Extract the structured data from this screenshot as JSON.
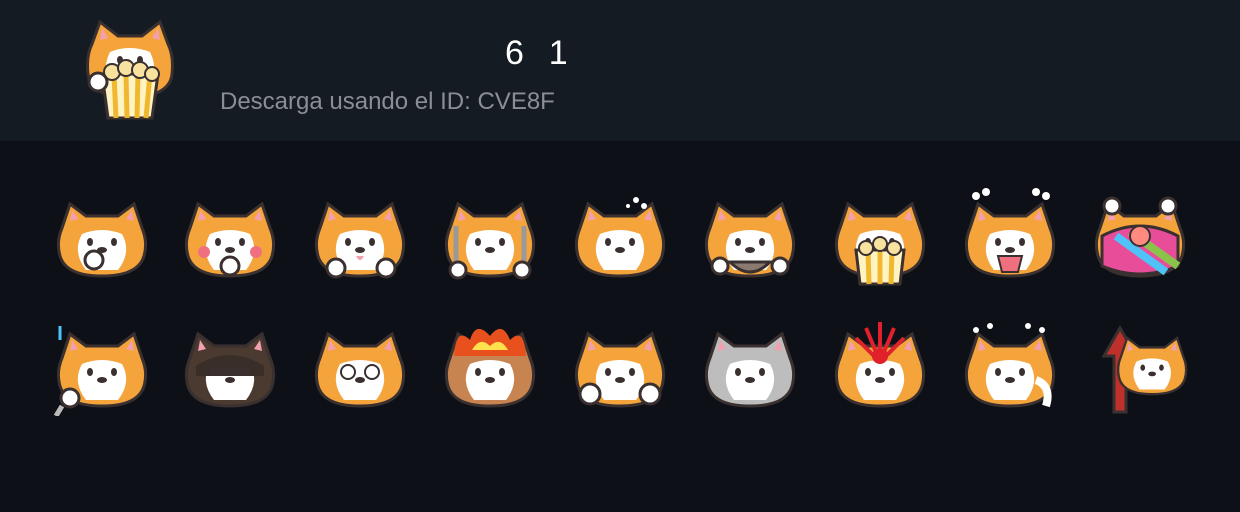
{
  "header": {
    "title": "6  1",
    "subtitle": "Descarga usando el ID: CVE8F"
  },
  "pack_icon": "cat-popcorn-icon",
  "stickers": [
    {
      "icon": "cat-smirk-icon"
    },
    {
      "icon": "cat-blush-icon"
    },
    {
      "icon": "cat-peek-icon"
    },
    {
      "icon": "cat-knife-fork-icon"
    },
    {
      "icon": "cat-dizzy-icon"
    },
    {
      "icon": "cat-bowl-icon"
    },
    {
      "icon": "cat-popcorn-icon"
    },
    {
      "icon": "cat-crying-icon"
    },
    {
      "icon": "cat-rainbow-icon"
    },
    {
      "icon": "cat-singing-icon"
    },
    {
      "icon": "cat-dark-icon"
    },
    {
      "icon": "cat-stare-icon"
    },
    {
      "icon": "cat-fire-icon"
    },
    {
      "icon": "cat-happy-icon"
    },
    {
      "icon": "cat-gray-icon"
    },
    {
      "icon": "cat-exploding-icon"
    },
    {
      "icon": "cat-sweating-icon"
    },
    {
      "icon": "cat-arrow-up-icon"
    }
  ],
  "colors": {
    "background": "#0d1117",
    "header": "#151b22",
    "cat_orange": "#f4a43a",
    "cat_white": "#ffffff",
    "outline": "#3a3030"
  }
}
